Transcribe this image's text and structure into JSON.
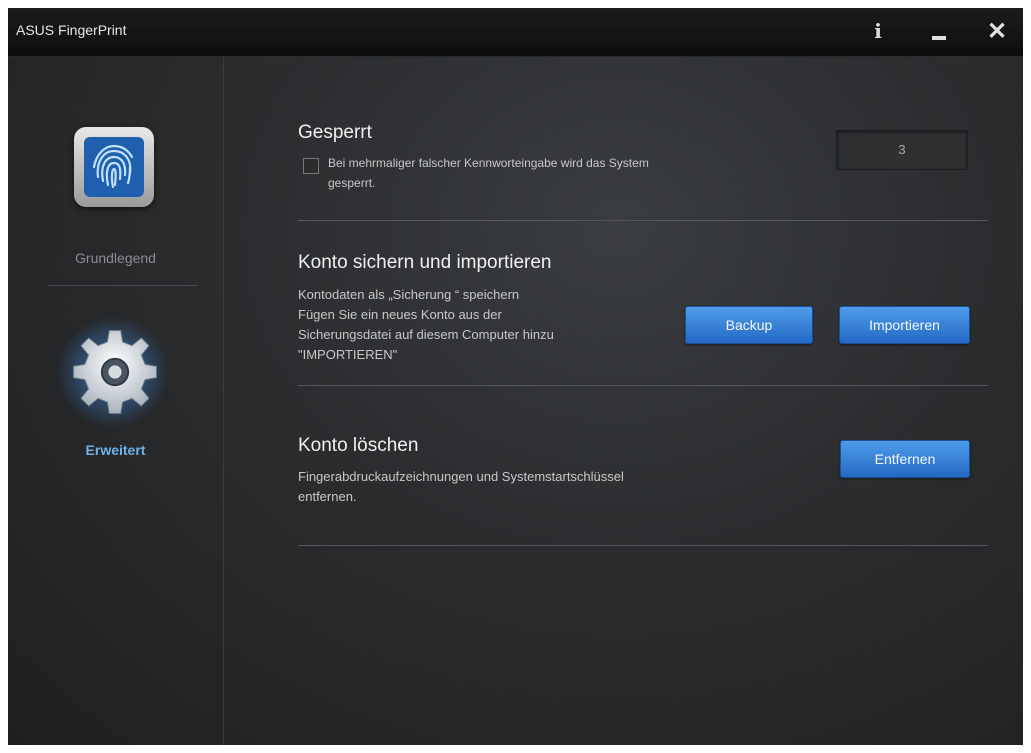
{
  "window": {
    "title": "ASUS FingerPrint",
    "info_glyph": "i",
    "close_glyph": "✕"
  },
  "sidebar": {
    "items": [
      {
        "label": "Grundlegend",
        "icon": "fingerprint-icon",
        "active": false
      },
      {
        "label": "Erweitert",
        "icon": "gear-icon",
        "active": true
      }
    ]
  },
  "lock_section": {
    "title": "Gesperrt",
    "checkbox_label_line1": "Bei mehrmaliger falscher Kennworteingabe wird das System",
    "checkbox_label_line2": "gesperrt.",
    "attempts_value": "3"
  },
  "backup_section": {
    "title": "Konto sichern und importieren",
    "description_lines": [
      "Kontodaten als „Sicherung “ speichern",
      "Fügen Sie ein neues Konto aus der",
      "Sicherungsdatei auf diesem Computer hinzu",
      "\"IMPORTIEREN\""
    ],
    "backup_label": "Backup",
    "import_label": "Importieren"
  },
  "delete_section": {
    "title": "Konto löschen",
    "description_lines": [
      "Fingerabdruckaufzeichnungen und Systemstartschlüssel",
      "entfernen."
    ],
    "remove_label": "Entfernen"
  },
  "colors": {
    "accent": "#3a85da",
    "active_label": "#6fb2e6"
  }
}
